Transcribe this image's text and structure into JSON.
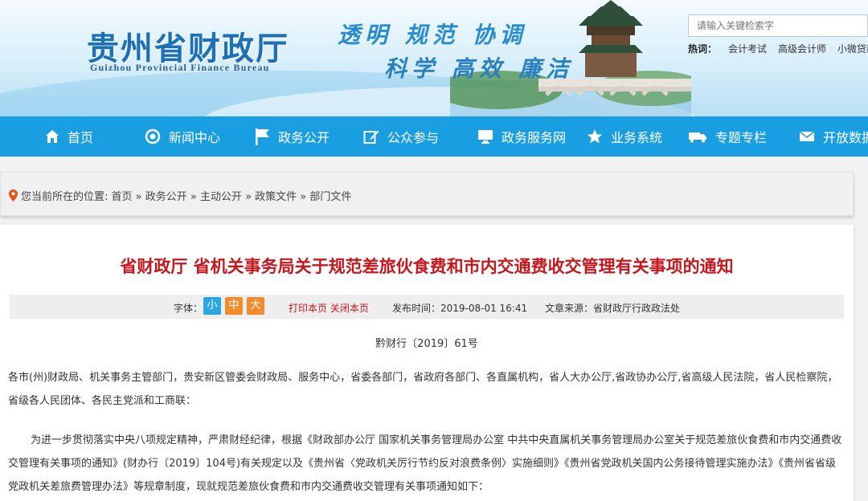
{
  "header": {
    "logo_cn": "贵州省财政厅",
    "logo_en": "Guizhou Provincial Finance Bureau",
    "slogan_line1": "透明 规范 协调",
    "slogan_line2": "科学 高效 廉洁"
  },
  "search": {
    "placeholder": "请输入关键检索字",
    "hot_label": "热词：",
    "hot_words": [
      "会计考试",
      "高级会计师",
      "小微贷款"
    ]
  },
  "nav": {
    "items": [
      {
        "label": "首页",
        "icon": "home-icon"
      },
      {
        "label": "新闻中心",
        "icon": "target-icon"
      },
      {
        "label": "政务公开",
        "icon": "flag-icon"
      },
      {
        "label": "公众参与",
        "icon": "edit-icon"
      },
      {
        "label": "政务服务网",
        "icon": "monitor-icon"
      },
      {
        "label": "业务系统",
        "icon": "star-icon"
      },
      {
        "label": "专题专栏",
        "icon": "truck-icon"
      },
      {
        "label": "开放数据",
        "icon": "mail-icon"
      }
    ]
  },
  "breadcrumb": {
    "text": "您当前所在的位置: 首页 » 政务公开 » 主动公开 » 政策文件 » 部门文件"
  },
  "article": {
    "title": "省财政厅 省机关事务局关于规范差旅伙食费和市内交通费收交管理有关事项的通知",
    "font_label": "字体：",
    "font_small": "小",
    "font_medium": "中",
    "font_large": "大",
    "print_close": "打印本页 关闭本页",
    "publish_time": "发布时间：2019-08-01 16:41",
    "source": "文章来源：省财政厅行政政法处",
    "doc_number": "黔财行〔2019〕61号",
    "para1": "各市(州)财政局、机关事务主管部门，贵安新区管委会财政局、服务中心，省委各部门，省政府各部门、各直属机构，省人大办公厅,省政协办公厅,省高级人民法院，省人民检察院，省级各人民团体、各民主党派和工商联：",
    "para2": "为进一步贯彻落实中央八项规定精神，严肃财经纪律，根据《财政部办公厅 国家机关事务管理局办公室 中共中央直属机关事务管理局办公室关于规范差旅伙食费和市内交通费收交管理有关事项的通知》(财办行〔2019〕104号)有关规定以及《贵州省〈党政机关厉行节约反对浪费条例〉实施细则》《贵州省党政机关国内公务接待管理实施办法》《贵州省省级党政机关差旅费管理办法》等规章制度，现就规范差旅伙食费和市内交通费收交管理有关事项通知如下："
  },
  "colors": {
    "nav_bg": "#1a9ee2",
    "title_red": "#c8161d",
    "logo_blue": "#1f6fb5"
  }
}
